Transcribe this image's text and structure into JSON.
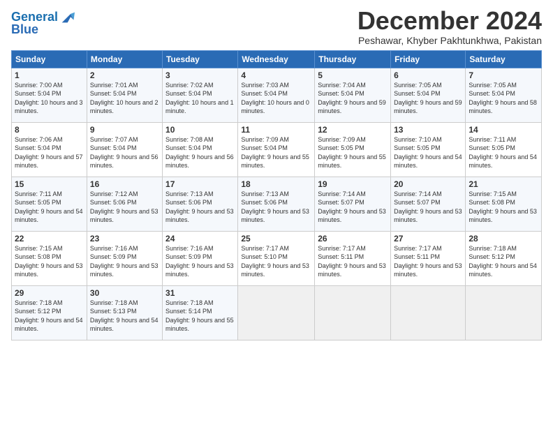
{
  "header": {
    "logo_line1": "General",
    "logo_line2": "Blue",
    "month": "December 2024",
    "location": "Peshawar, Khyber Pakhtunkhwa, Pakistan"
  },
  "weekdays": [
    "Sunday",
    "Monday",
    "Tuesday",
    "Wednesday",
    "Thursday",
    "Friday",
    "Saturday"
  ],
  "weeks": [
    [
      {
        "day": "1",
        "sunrise": "Sunrise: 7:00 AM",
        "sunset": "Sunset: 5:04 PM",
        "daylight": "Daylight: 10 hours and 3 minutes."
      },
      {
        "day": "2",
        "sunrise": "Sunrise: 7:01 AM",
        "sunset": "Sunset: 5:04 PM",
        "daylight": "Daylight: 10 hours and 2 minutes."
      },
      {
        "day": "3",
        "sunrise": "Sunrise: 7:02 AM",
        "sunset": "Sunset: 5:04 PM",
        "daylight": "Daylight: 10 hours and 1 minute."
      },
      {
        "day": "4",
        "sunrise": "Sunrise: 7:03 AM",
        "sunset": "Sunset: 5:04 PM",
        "daylight": "Daylight: 10 hours and 0 minutes."
      },
      {
        "day": "5",
        "sunrise": "Sunrise: 7:04 AM",
        "sunset": "Sunset: 5:04 PM",
        "daylight": "Daylight: 9 hours and 59 minutes."
      },
      {
        "day": "6",
        "sunrise": "Sunrise: 7:05 AM",
        "sunset": "Sunset: 5:04 PM",
        "daylight": "Daylight: 9 hours and 59 minutes."
      },
      {
        "day": "7",
        "sunrise": "Sunrise: 7:05 AM",
        "sunset": "Sunset: 5:04 PM",
        "daylight": "Daylight: 9 hours and 58 minutes."
      }
    ],
    [
      {
        "day": "8",
        "sunrise": "Sunrise: 7:06 AM",
        "sunset": "Sunset: 5:04 PM",
        "daylight": "Daylight: 9 hours and 57 minutes."
      },
      {
        "day": "9",
        "sunrise": "Sunrise: 7:07 AM",
        "sunset": "Sunset: 5:04 PM",
        "daylight": "Daylight: 9 hours and 56 minutes."
      },
      {
        "day": "10",
        "sunrise": "Sunrise: 7:08 AM",
        "sunset": "Sunset: 5:04 PM",
        "daylight": "Daylight: 9 hours and 56 minutes."
      },
      {
        "day": "11",
        "sunrise": "Sunrise: 7:09 AM",
        "sunset": "Sunset: 5:04 PM",
        "daylight": "Daylight: 9 hours and 55 minutes."
      },
      {
        "day": "12",
        "sunrise": "Sunrise: 7:09 AM",
        "sunset": "Sunset: 5:05 PM",
        "daylight": "Daylight: 9 hours and 55 minutes."
      },
      {
        "day": "13",
        "sunrise": "Sunrise: 7:10 AM",
        "sunset": "Sunset: 5:05 PM",
        "daylight": "Daylight: 9 hours and 54 minutes."
      },
      {
        "day": "14",
        "sunrise": "Sunrise: 7:11 AM",
        "sunset": "Sunset: 5:05 PM",
        "daylight": "Daylight: 9 hours and 54 minutes."
      }
    ],
    [
      {
        "day": "15",
        "sunrise": "Sunrise: 7:11 AM",
        "sunset": "Sunset: 5:05 PM",
        "daylight": "Daylight: 9 hours and 54 minutes."
      },
      {
        "day": "16",
        "sunrise": "Sunrise: 7:12 AM",
        "sunset": "Sunset: 5:06 PM",
        "daylight": "Daylight: 9 hours and 53 minutes."
      },
      {
        "day": "17",
        "sunrise": "Sunrise: 7:13 AM",
        "sunset": "Sunset: 5:06 PM",
        "daylight": "Daylight: 9 hours and 53 minutes."
      },
      {
        "day": "18",
        "sunrise": "Sunrise: 7:13 AM",
        "sunset": "Sunset: 5:06 PM",
        "daylight": "Daylight: 9 hours and 53 minutes."
      },
      {
        "day": "19",
        "sunrise": "Sunrise: 7:14 AM",
        "sunset": "Sunset: 5:07 PM",
        "daylight": "Daylight: 9 hours and 53 minutes."
      },
      {
        "day": "20",
        "sunrise": "Sunrise: 7:14 AM",
        "sunset": "Sunset: 5:07 PM",
        "daylight": "Daylight: 9 hours and 53 minutes."
      },
      {
        "day": "21",
        "sunrise": "Sunrise: 7:15 AM",
        "sunset": "Sunset: 5:08 PM",
        "daylight": "Daylight: 9 hours and 53 minutes."
      }
    ],
    [
      {
        "day": "22",
        "sunrise": "Sunrise: 7:15 AM",
        "sunset": "Sunset: 5:08 PM",
        "daylight": "Daylight: 9 hours and 53 minutes."
      },
      {
        "day": "23",
        "sunrise": "Sunrise: 7:16 AM",
        "sunset": "Sunset: 5:09 PM",
        "daylight": "Daylight: 9 hours and 53 minutes."
      },
      {
        "day": "24",
        "sunrise": "Sunrise: 7:16 AM",
        "sunset": "Sunset: 5:09 PM",
        "daylight": "Daylight: 9 hours and 53 minutes."
      },
      {
        "day": "25",
        "sunrise": "Sunrise: 7:17 AM",
        "sunset": "Sunset: 5:10 PM",
        "daylight": "Daylight: 9 hours and 53 minutes."
      },
      {
        "day": "26",
        "sunrise": "Sunrise: 7:17 AM",
        "sunset": "Sunset: 5:11 PM",
        "daylight": "Daylight: 9 hours and 53 minutes."
      },
      {
        "day": "27",
        "sunrise": "Sunrise: 7:17 AM",
        "sunset": "Sunset: 5:11 PM",
        "daylight": "Daylight: 9 hours and 53 minutes."
      },
      {
        "day": "28",
        "sunrise": "Sunrise: 7:18 AM",
        "sunset": "Sunset: 5:12 PM",
        "daylight": "Daylight: 9 hours and 54 minutes."
      }
    ],
    [
      {
        "day": "29",
        "sunrise": "Sunrise: 7:18 AM",
        "sunset": "Sunset: 5:12 PM",
        "daylight": "Daylight: 9 hours and 54 minutes."
      },
      {
        "day": "30",
        "sunrise": "Sunrise: 7:18 AM",
        "sunset": "Sunset: 5:13 PM",
        "daylight": "Daylight: 9 hours and 54 minutes."
      },
      {
        "day": "31",
        "sunrise": "Sunrise: 7:18 AM",
        "sunset": "Sunset: 5:14 PM",
        "daylight": "Daylight: 9 hours and 55 minutes."
      },
      null,
      null,
      null,
      null
    ]
  ]
}
